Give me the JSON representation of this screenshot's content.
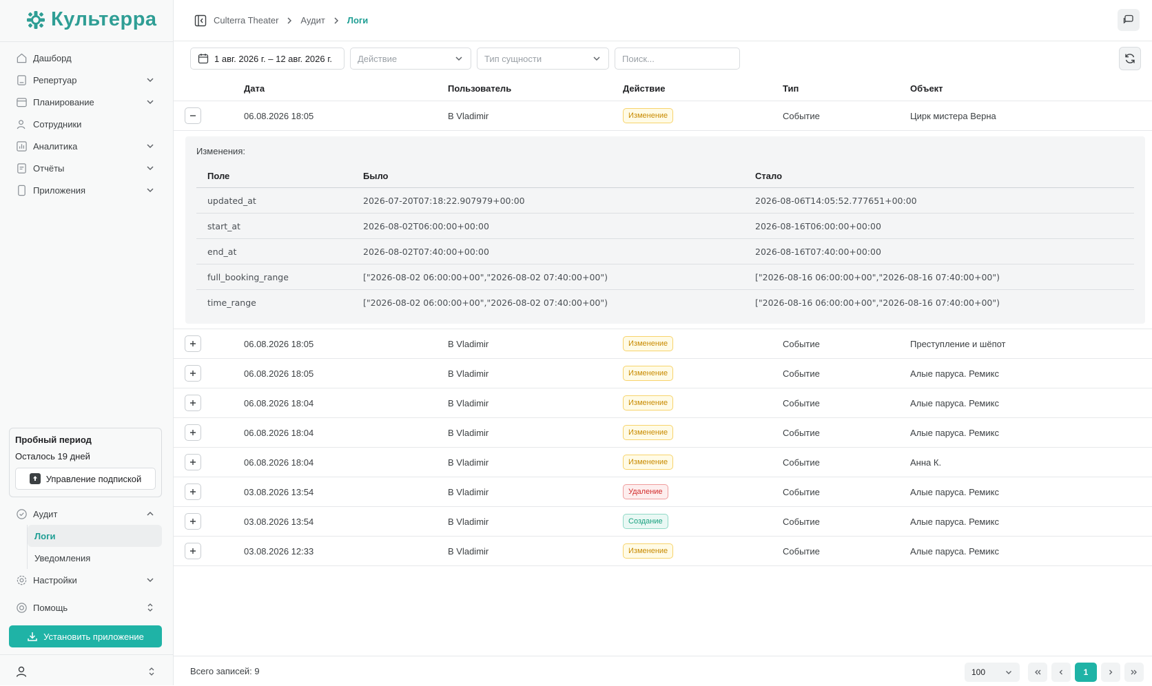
{
  "app": {
    "logo_text": "Культерра",
    "brand_color": "#1fb3a6"
  },
  "sidebar": {
    "items": [
      {
        "label": "Дашборд",
        "icon": "home-icon",
        "has_chevron": false
      },
      {
        "label": "Репертуар",
        "icon": "tablet-icon",
        "has_chevron": true
      },
      {
        "label": "Планирование",
        "icon": "calendar-icon",
        "has_chevron": true
      },
      {
        "label": "Сотрудники",
        "icon": "users-icon",
        "has_chevron": false
      },
      {
        "label": "Аналитика",
        "icon": "chart-icon",
        "has_chevron": true
      },
      {
        "label": "Отчёты",
        "icon": "report-icon",
        "has_chevron": true
      },
      {
        "label": "Приложения",
        "icon": "phone-icon",
        "has_chevron": true
      }
    ],
    "trial": {
      "title": "Пробный период",
      "remaining": "Осталось 19 дней",
      "manage_button": "Управление подпиской"
    },
    "audit": {
      "label": "Аудит",
      "children": [
        {
          "label": "Логи",
          "active": true
        },
        {
          "label": "Уведомления",
          "active": false
        }
      ]
    },
    "settings_label": "Настройки",
    "help_label": "Помощь",
    "install_button": "Установить приложение"
  },
  "header": {
    "breadcrumb": [
      "Culterra Theater",
      "Аудит",
      "Логи"
    ]
  },
  "filters": {
    "date_range": "1 авг. 2026 г. – 12 авг. 2026 г.",
    "action_placeholder": "Действие",
    "entity_type_placeholder": "Тип сущности",
    "search_placeholder": "Поиск..."
  },
  "table": {
    "columns": [
      "Дата",
      "Пользователь",
      "Действие",
      "Тип",
      "Объект"
    ],
    "rows": [
      {
        "date": "06.08.2026 18:05",
        "user": "B Vladimir",
        "action": "Изменение",
        "action_kind": "update",
        "type": "Событие",
        "object": "Цирк мистера Верна",
        "expanded": true
      },
      {
        "date": "06.08.2026 18:05",
        "user": "B Vladimir",
        "action": "Изменение",
        "action_kind": "update",
        "type": "Событие",
        "object": "Преступление и шёпот",
        "expanded": false
      },
      {
        "date": "06.08.2026 18:05",
        "user": "B Vladimir",
        "action": "Изменение",
        "action_kind": "update",
        "type": "Событие",
        "object": "Алые паруса. Ремикс",
        "expanded": false
      },
      {
        "date": "06.08.2026 18:04",
        "user": "B Vladimir",
        "action": "Изменение",
        "action_kind": "update",
        "type": "Событие",
        "object": "Алые паруса. Ремикс",
        "expanded": false
      },
      {
        "date": "06.08.2026 18:04",
        "user": "B Vladimir",
        "action": "Изменение",
        "action_kind": "update",
        "type": "Событие",
        "object": "Алые паруса. Ремикс",
        "expanded": false
      },
      {
        "date": "06.08.2026 18:04",
        "user": "B Vladimir",
        "action": "Изменение",
        "action_kind": "update",
        "type": "Событие",
        "object": "Анна К.",
        "expanded": false
      },
      {
        "date": "03.08.2026 13:54",
        "user": "B Vladimir",
        "action": "Удаление",
        "action_kind": "delete",
        "type": "Событие",
        "object": "Алые паруса. Ремикс",
        "expanded": false
      },
      {
        "date": "03.08.2026 13:54",
        "user": "B Vladimir",
        "action": "Создание",
        "action_kind": "create",
        "type": "Событие",
        "object": "Алые паруса. Ремикс",
        "expanded": false
      },
      {
        "date": "03.08.2026 12:33",
        "user": "B Vladimir",
        "action": "Изменение",
        "action_kind": "update",
        "type": "Событие",
        "object": "Алые паруса. Ремикс",
        "expanded": false
      }
    ]
  },
  "details": {
    "title": "Изменения:",
    "columns": [
      "Поле",
      "Было",
      "Стало"
    ],
    "rows": [
      {
        "field": "updated_at",
        "was": "2026-07-20T07:18:22.907979+00:00",
        "now": "2026-08-06T14:05:52.777651+00:00"
      },
      {
        "field": "start_at",
        "was": "2026-08-02T06:00:00+00:00",
        "now": "2026-08-16T06:00:00+00:00"
      },
      {
        "field": "end_at",
        "was": "2026-08-02T07:40:00+00:00",
        "now": "2026-08-16T07:40:00+00:00"
      },
      {
        "field": "full_booking_range",
        "was": "[\"2026-08-02 06:00:00+00\",\"2026-08-02 07:40:00+00\")",
        "now": "[\"2026-08-16 06:00:00+00\",\"2026-08-16 07:40:00+00\")"
      },
      {
        "field": "time_range",
        "was": "[\"2026-08-02 06:00:00+00\",\"2026-08-02 07:40:00+00\")",
        "now": "[\"2026-08-16 06:00:00+00\",\"2026-08-16 07:40:00+00\")"
      }
    ]
  },
  "footer": {
    "total": "Всего записей: 9",
    "page_size": "100",
    "current_page": "1"
  }
}
